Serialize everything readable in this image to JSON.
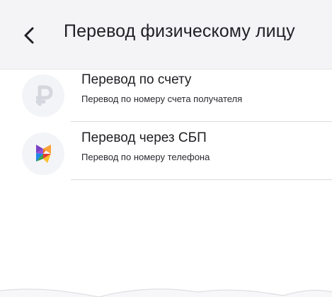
{
  "header": {
    "back_icon": "chevron-left-icon",
    "title": "Перевод физическому лицу"
  },
  "items": [
    {
      "icon": "ruble-icon",
      "title": "Перевод по счету",
      "subtitle": "Перевод по номеру счета получателя"
    },
    {
      "icon": "sbp-logo-icon",
      "title": "Перевод через СБП",
      "subtitle": "Перевод по номеру телефона"
    }
  ],
  "colors": {
    "header_bg": "#f4f4f6",
    "text": "#1f1f24",
    "icon_bg": "#f3f4f7",
    "ruble_icon": "#d5d7de"
  }
}
